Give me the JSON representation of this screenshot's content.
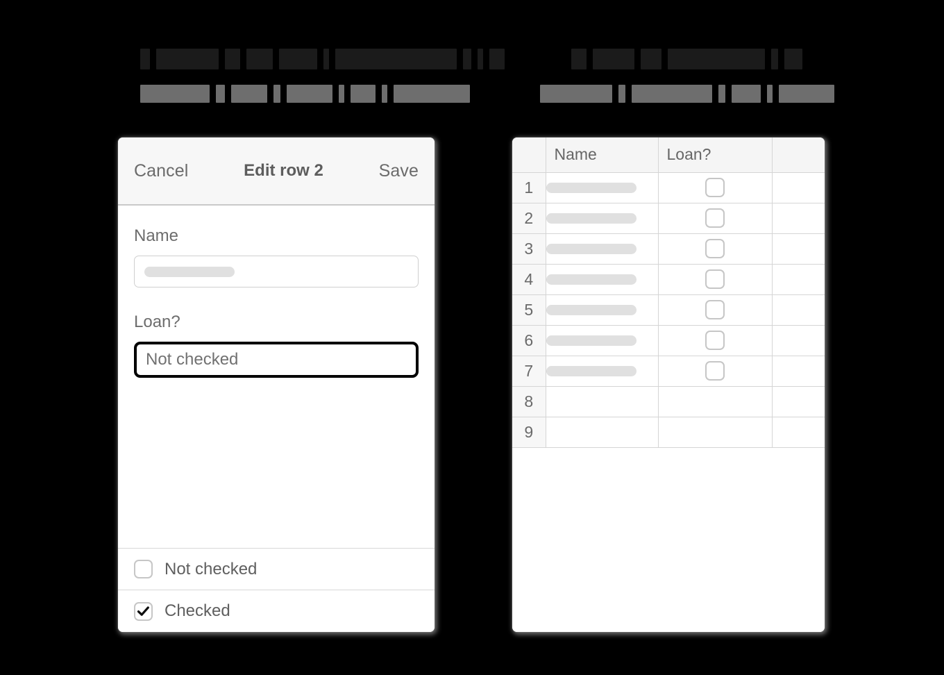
{
  "captions": [
    {
      "id": "left-caption",
      "redacted": true,
      "lines": [
        {
          "style": "dark",
          "blocks": [
            14,
            90,
            22,
            38,
            55,
            8,
            175,
            12,
            8,
            22
          ]
        },
        {
          "style": "gray",
          "blocks": [
            100,
            13,
            52,
            10,
            66,
            8,
            36,
            8,
            110
          ]
        }
      ]
    },
    {
      "id": "right-caption",
      "redacted": true,
      "lines": [
        {
          "style": "dark",
          "blocks": [
            22,
            60,
            30,
            140,
            10,
            26
          ]
        },
        {
          "style": "gray",
          "blocks": [
            104,
            10,
            116,
            10,
            42,
            8,
            80
          ]
        }
      ]
    }
  ],
  "editor": {
    "header": {
      "cancel_label": "Cancel",
      "title": "Edit row 2",
      "save_label": "Save"
    },
    "fields": [
      {
        "label": "Name",
        "type": "text",
        "value": "",
        "value_redacted": true,
        "redaction_width": 130
      },
      {
        "label": "Loan?",
        "type": "select",
        "value": "Not checked",
        "focused": true
      }
    ],
    "options": [
      {
        "label": "Not checked",
        "checked": false
      },
      {
        "label": "Checked",
        "checked": true
      }
    ]
  },
  "grid": {
    "columns": [
      "",
      "Name",
      "Loan?",
      ""
    ],
    "rows": [
      {
        "num": "1",
        "name_redacted": true,
        "name_width": 130,
        "loan_checkbox": true,
        "loan_checked": false
      },
      {
        "num": "2",
        "name_redacted": true,
        "name_width": 130,
        "loan_checkbox": true,
        "loan_checked": false
      },
      {
        "num": "3",
        "name_redacted": true,
        "name_width": 130,
        "loan_checkbox": true,
        "loan_checked": false
      },
      {
        "num": "4",
        "name_redacted": true,
        "name_width": 130,
        "loan_checkbox": true,
        "loan_checked": false
      },
      {
        "num": "5",
        "name_redacted": true,
        "name_width": 130,
        "loan_checkbox": true,
        "loan_checked": false
      },
      {
        "num": "6",
        "name_redacted": true,
        "name_width": 130,
        "loan_checkbox": true,
        "loan_checked": false
      },
      {
        "num": "7",
        "name_redacted": true,
        "name_width": 130,
        "loan_checkbox": true,
        "loan_checked": false
      },
      {
        "num": "8",
        "name_redacted": false,
        "loan_checkbox": false
      },
      {
        "num": "9",
        "name_redacted": false,
        "loan_checkbox": false
      }
    ]
  },
  "colors": {
    "background": "#000000",
    "panel": "#ffffff",
    "header_bar": "#f7f7f7",
    "border": "#d5d5d5",
    "text": "#6a6a6a",
    "focus_outline": "#000000",
    "redaction_light": "#e0e0e0",
    "redaction_dark": "#1b1b1b",
    "redaction_gray": "#6e6e6e"
  }
}
